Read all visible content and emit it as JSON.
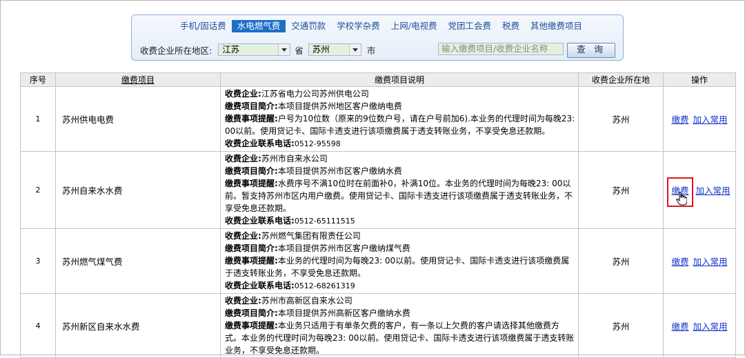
{
  "tabs": [
    {
      "label": "手机/固话费",
      "active": false
    },
    {
      "label": "水电燃气费",
      "active": true
    },
    {
      "label": "交通罚款",
      "active": false
    },
    {
      "label": "学校学杂费",
      "active": false
    },
    {
      "label": "上网/电视费",
      "active": false
    },
    {
      "label": "党团工会费",
      "active": false
    },
    {
      "label": "税费",
      "active": false
    },
    {
      "label": "其他缴费项目",
      "active": false
    }
  ],
  "filter": {
    "region_label": "收费企业所在地区:",
    "province_value": "江苏",
    "province_unit": "省",
    "city_value": "苏州",
    "city_unit": "市",
    "search_placeholder": "输入缴费项目/收费企业名称",
    "query_button": "查 询"
  },
  "table": {
    "headers": {
      "index": "序号",
      "item": "缴费项目",
      "desc": "缴费项目说明",
      "region": "收费企业所在地",
      "ops": "操作"
    },
    "labels": {
      "company": "收费企业:",
      "intro": "缴费项目简介:",
      "notice": "缴费事项提醒:",
      "phone": "收费企业联系电话:"
    },
    "actions": {
      "pay": "缴费",
      "add": "加入常用"
    },
    "rows": [
      {
        "index": "1",
        "item": "苏州供电电费",
        "company": "江苏省电力公司苏州供电公司",
        "intro": "本项目提供苏州地区客户缴纳电费",
        "notice": "户号为10位数（原来的9位数户号，请在户号前加6).本业务的代理时间为每晚23: 00以前。使用贷记卡、国际卡透支进行该项缴费属于透支转账业务，不享受免息还款期。",
        "phone": "0512-95598",
        "region": "苏州"
      },
      {
        "index": "2",
        "item": "苏州自来水水费",
        "company": "苏州市自来水公司",
        "intro": "本项目提供苏州市区客户缴纳水费",
        "notice": "水费序号不满10位时在前面补0，补满10位。本业务的代理时间为每晚23: 00以前。暂支持苏州市区内用户缴费。使用贷记卡、国际卡透支进行该项缴费属于透支转账业务，不享受免息还款期。",
        "phone": "0512-65111515",
        "region": "苏州"
      },
      {
        "index": "3",
        "item": "苏州燃气煤气费",
        "company": "苏州燃气集团有限责任公司",
        "intro": "本项目提供苏州市区客户缴纳煤气费",
        "notice": "本业务的代理时间为每晚23: 00以前。使用贷记卡、国际卡透支进行该项缴费属于透支转账业务，不享受免息还款期。",
        "phone": "0512-68261319",
        "region": "苏州"
      },
      {
        "index": "4",
        "item": "苏州新区自来水水费",
        "company": "苏州市高新区自来水公司",
        "intro": "本项目提供苏州高新区客户缴纳水费",
        "notice": "本业务只适用于有单条欠费的客户，有一条以上欠费的客户请选择其他缴费方式。本业务的代理时间为每晚23: 00以前。使用贷记卡、国际卡透支进行该项缴费属于透支转账业务，不享受免息还款期。",
        "phone": "",
        "region": "苏州"
      }
    ]
  },
  "highlight_color": "#e0141e",
  "accent_color": "#1f6ec7"
}
